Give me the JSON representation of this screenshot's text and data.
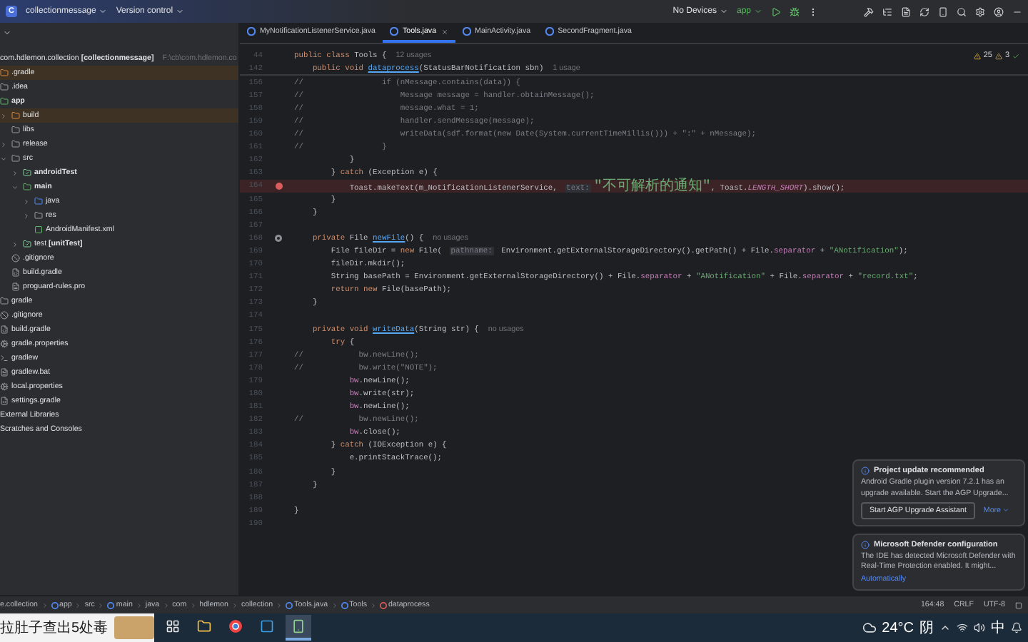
{
  "toolbar": {
    "project_initial": "C",
    "project": "collectionmessage",
    "vcs": "Version control",
    "device": "No Devices",
    "run_config": "app"
  },
  "tabs": [
    {
      "label": "MyNotificationListenerService.java",
      "selected": false
    },
    {
      "label": "Tools.java",
      "selected": true
    },
    {
      "label": "MainActivity.java",
      "selected": false
    },
    {
      "label": "SecondFragment.java",
      "selected": false
    }
  ],
  "project_tree": {
    "root": "com.hdlemon.collection **[collectionmessage]**",
    "root_path": "F:\\cb\\com.hdlemon.co",
    "items": [
      {
        "label": ".gradle",
        "kind": "excluded",
        "highlighted": true
      },
      {
        "label": ".idea",
        "kind": "folder",
        "highlighted": false
      },
      {
        "label": "**app**",
        "kind": "module",
        "highlighted": false,
        "children": [
          {
            "label": "build",
            "kind": "excluded",
            "highlighted": true,
            "expanded": false
          },
          {
            "label": "libs",
            "kind": "folder",
            "highlighted": false
          },
          {
            "label": "release",
            "kind": "folder",
            "highlighted": false,
            "expanded": false
          },
          {
            "label": "src",
            "kind": "folder",
            "highlighted": false,
            "expanded": true,
            "children": [
              {
                "label": "**androidTest**",
                "kind": "test",
                "highlighted": false,
                "expanded": false
              },
              {
                "label": "**main**",
                "kind": "module",
                "highlighted": false,
                "expanded": true,
                "children": [
                  {
                    "label": "java",
                    "kind": "source",
                    "highlighted": false,
                    "expanded": false
                  },
                  {
                    "label": "res",
                    "kind": "folder",
                    "highlighted": false,
                    "expanded": false
                  },
                  {
                    "label": "AndroidManifest.xml",
                    "kind": "manifest",
                    "highlighted": false
                  }
                ]
              },
              {
                "label": "test **[unitTest]**",
                "kind": "test",
                "highlighted": false,
                "expanded": false
              }
            ]
          },
          {
            "label": ".gitignore",
            "kind": "ignore",
            "highlighted": false
          },
          {
            "label": "build.gradle",
            "kind": "gradle",
            "highlighted": false
          },
          {
            "label": "proguard-rules.pro",
            "kind": "lines",
            "highlighted": false
          }
        ]
      },
      {
        "label": "gradle",
        "kind": "folder",
        "highlighted": false
      },
      {
        "label": ".gitignore",
        "kind": "ignore",
        "highlighted": false
      },
      {
        "label": "build.gradle",
        "kind": "gradle",
        "highlighted": false
      },
      {
        "label": "gradle.properties",
        "kind": "settings",
        "highlighted": false
      },
      {
        "label": "gradlew",
        "kind": "script",
        "highlighted": false
      },
      {
        "label": "gradlew.bat",
        "kind": "lines",
        "highlighted": false
      },
      {
        "label": "local.properties",
        "kind": "settings",
        "highlighted": false
      },
      {
        "label": "settings.gradle",
        "kind": "gradle",
        "highlighted": false
      },
      {
        "label": "External Libraries",
        "kind": "plain",
        "highlighted": false
      },
      {
        "label": "Scratches and Consoles",
        "kind": "plain",
        "highlighted": false
      }
    ]
  },
  "editor": {
    "warnings": "25",
    "weak_warnings": "3",
    "sticky": [
      {
        "number": "44",
        "tokens": [
          {
            "kind": "kw",
            "text": "public class "
          },
          {
            "kind": "txt",
            "text": "Tools {  "
          },
          {
            "kind": "hint",
            "text": "12 usages"
          }
        ]
      },
      {
        "number": "142",
        "tokens": [
          {
            "kind": "kw",
            "text": "    public void "
          },
          {
            "kind": "fn",
            "text": "dataprocess"
          },
          {
            "kind": "txt",
            "text": "(StatusBarNotification sbn)  "
          },
          {
            "kind": "hint",
            "text": "1 usage"
          }
        ]
      }
    ],
    "lines": [
      {
        "number": "156",
        "breakpoint": false,
        "annotated": false,
        "tokens": [
          {
            "kind": "com",
            "text": "//                 if (nMessage.contains(data)) {"
          }
        ]
      },
      {
        "number": "157",
        "breakpoint": false,
        "annotated": false,
        "tokens": [
          {
            "kind": "com",
            "text": "//                     Message message = handler.obtainMessage();"
          }
        ]
      },
      {
        "number": "158",
        "breakpoint": false,
        "annotated": false,
        "tokens": [
          {
            "kind": "com",
            "text": "//                     message.what = 1;"
          }
        ]
      },
      {
        "number": "159",
        "breakpoint": false,
        "annotated": false,
        "tokens": [
          {
            "kind": "com",
            "text": "//                     handler.sendMessage(message);"
          }
        ]
      },
      {
        "number": "160",
        "breakpoint": false,
        "annotated": false,
        "tokens": [
          {
            "kind": "com",
            "text": "//                     writeData(sdf.format(new Date(System.currentTimeMillis())) + \":\" + nMessage);"
          }
        ]
      },
      {
        "number": "161",
        "breakpoint": false,
        "annotated": false,
        "tokens": [
          {
            "kind": "com",
            "text": "//                 }"
          }
        ]
      },
      {
        "number": "162",
        "breakpoint": false,
        "annotated": false,
        "tokens": [
          {
            "kind": "txt",
            "text": "            }"
          }
        ]
      },
      {
        "number": "163",
        "breakpoint": false,
        "annotated": false,
        "tokens": [
          {
            "kind": "txt",
            "text": "        } "
          },
          {
            "kind": "kw",
            "text": "catch "
          },
          {
            "kind": "txt",
            "text": "(Exception e) {"
          }
        ]
      },
      {
        "number": "164",
        "breakpoint": true,
        "annotated": false,
        "tokens": [
          {
            "kind": "txt",
            "text": "            Toast.makeText(m_NotificationListenerService, "
          },
          {
            "kind": "chip",
            "text": "text:"
          },
          {
            "kind": "str",
            "text": "\"不可解析的通知\""
          },
          {
            "kind": "txt",
            "text": ", Toast."
          },
          {
            "kind": "ital",
            "text": "LENGTH_SHORT"
          },
          {
            "kind": "txt",
            "text": ").show();"
          }
        ]
      },
      {
        "number": "165",
        "breakpoint": false,
        "annotated": false,
        "tokens": [
          {
            "kind": "txt",
            "text": "        }"
          }
        ]
      },
      {
        "number": "166",
        "breakpoint": false,
        "annotated": false,
        "tokens": [
          {
            "kind": "txt",
            "text": "    }"
          }
        ]
      },
      {
        "number": "167",
        "breakpoint": false,
        "annotated": false
      },
      {
        "number": "168",
        "breakpoint": false,
        "annotated": true,
        "tokens": [
          {
            "kind": "kw",
            "text": "    private "
          },
          {
            "kind": "txt",
            "text": "File "
          },
          {
            "kind": "fn",
            "text": "newFile"
          },
          {
            "kind": "txt",
            "text": "() {  "
          },
          {
            "kind": "hint",
            "text": "no usages"
          }
        ]
      },
      {
        "number": "169",
        "breakpoint": false,
        "annotated": false,
        "tokens": [
          {
            "kind": "txt",
            "text": "        File fileDir = "
          },
          {
            "kind": "kw",
            "text": "new "
          },
          {
            "kind": "txt",
            "text": "File( "
          },
          {
            "kind": "chip",
            "text": "pathname:"
          },
          {
            "kind": "txt",
            "text": " Environment.getExternalStorageDirectory().getPath() + File."
          },
          {
            "kind": "fld",
            "text": "separator"
          },
          {
            "kind": "txt",
            "text": " + "
          },
          {
            "kind": "str",
            "text": "\"ANotification\""
          },
          {
            "kind": "txt",
            "text": ");"
          }
        ]
      },
      {
        "number": "170",
        "breakpoint": false,
        "annotated": false,
        "tokens": [
          {
            "kind": "txt",
            "text": "        fileDir.mkdir();"
          }
        ]
      },
      {
        "number": "171",
        "breakpoint": false,
        "annotated": false,
        "tokens": [
          {
            "kind": "txt",
            "text": "        String basePath = Environment.getExternalStorageDirectory() + File."
          },
          {
            "kind": "fld",
            "text": "separator"
          },
          {
            "kind": "txt",
            "text": " + "
          },
          {
            "kind": "str",
            "text": "\"ANotification\""
          },
          {
            "kind": "txt",
            "text": " + File."
          },
          {
            "kind": "fld",
            "text": "separator"
          },
          {
            "kind": "txt",
            "text": " + "
          },
          {
            "kind": "str",
            "text": "\"record.txt\""
          },
          {
            "kind": "txt",
            "text": ";"
          }
        ]
      },
      {
        "number": "172",
        "breakpoint": false,
        "annotated": false,
        "tokens": [
          {
            "kind": "kw",
            "text": "        return new "
          },
          {
            "kind": "txt",
            "text": "File(basePath);"
          }
        ]
      },
      {
        "number": "173",
        "breakpoint": false,
        "annotated": false,
        "tokens": [
          {
            "kind": "txt",
            "text": "    }"
          }
        ]
      },
      {
        "number": "174",
        "breakpoint": false,
        "annotated": false
      },
      {
        "number": "175",
        "breakpoint": false,
        "annotated": false,
        "tokens": [
          {
            "kind": "kw",
            "text": "    private void "
          },
          {
            "kind": "fn",
            "text": "writeData"
          },
          {
            "kind": "txt",
            "text": "(String str) {  "
          },
          {
            "kind": "hint",
            "text": "no usages"
          }
        ]
      },
      {
        "number": "176",
        "breakpoint": false,
        "annotated": false,
        "tokens": [
          {
            "kind": "kw",
            "text": "        try "
          },
          {
            "kind": "txt",
            "text": "{"
          }
        ]
      },
      {
        "number": "177",
        "breakpoint": false,
        "annotated": false,
        "tokens": [
          {
            "kind": "com",
            "text": "//            bw.newLine();"
          }
        ]
      },
      {
        "number": "178",
        "breakpoint": false,
        "annotated": false,
        "tokens": [
          {
            "kind": "com",
            "text": "//            bw.write(\"NOTE\");"
          }
        ]
      },
      {
        "number": "179",
        "breakpoint": false,
        "annotated": false,
        "tokens": [
          {
            "kind": "fld",
            "text": "            bw"
          },
          {
            "kind": "txt",
            "text": ".newLine();"
          }
        ]
      },
      {
        "number": "180",
        "breakpoint": false,
        "annotated": false,
        "tokens": [
          {
            "kind": "fld",
            "text": "            bw"
          },
          {
            "kind": "txt",
            "text": ".write(str);"
          }
        ]
      },
      {
        "number": "181",
        "breakpoint": false,
        "annotated": false,
        "tokens": [
          {
            "kind": "fld",
            "text": "            bw"
          },
          {
            "kind": "txt",
            "text": ".newLine();"
          }
        ]
      },
      {
        "number": "182",
        "breakpoint": false,
        "annotated": false,
        "tokens": [
          {
            "kind": "com",
            "text": "//            bw.newLine();"
          }
        ]
      },
      {
        "number": "183",
        "breakpoint": false,
        "annotated": false,
        "tokens": [
          {
            "kind": "fld",
            "text": "            bw"
          },
          {
            "kind": "txt",
            "text": ".close();"
          }
        ]
      },
      {
        "number": "184",
        "breakpoint": false,
        "annotated": false,
        "tokens": [
          {
            "kind": "txt",
            "text": "        } "
          },
          {
            "kind": "kw",
            "text": "catch "
          },
          {
            "kind": "txt",
            "text": "(IOException e) {"
          }
        ]
      },
      {
        "number": "185",
        "breakpoint": false,
        "annotated": false,
        "tokens": [
          {
            "kind": "txt",
            "text": "            e.printStackTrace();"
          }
        ]
      },
      {
        "number": "186",
        "breakpoint": false,
        "annotated": false,
        "tokens": [
          {
            "kind": "txt",
            "text": "        }"
          }
        ]
      },
      {
        "number": "187",
        "breakpoint": false,
        "annotated": false,
        "tokens": [
          {
            "kind": "txt",
            "text": "    }"
          }
        ]
      },
      {
        "number": "188",
        "breakpoint": false,
        "annotated": false
      },
      {
        "number": "189",
        "breakpoint": false,
        "annotated": false,
        "tokens": [
          {
            "kind": "txt",
            "text": "}"
          }
        ]
      },
      {
        "number": "190",
        "breakpoint": false,
        "annotated": false
      }
    ]
  },
  "notifications": [
    {
      "title": "Project update recommended",
      "body": "Android Gradle plugin version 7.2.1 has an upgrade available. Start the AGP Upgrade...",
      "action": "Start AGP Upgrade Assistant",
      "link": "More"
    },
    {
      "title": "Microsoft Defender configuration",
      "body": "The IDE has detected Microsoft Defender with Real-Time Protection enabled. It might...",
      "link": "Automatically"
    }
  ],
  "status_bar": {
    "breadcrumbs": [
      {
        "label": "e.collection",
        "kind": "plain"
      },
      {
        "label": "app",
        "kind": "module"
      },
      {
        "label": "src",
        "kind": "plain"
      },
      {
        "label": "main",
        "kind": "module"
      },
      {
        "label": "java",
        "kind": "plain"
      },
      {
        "label": "com",
        "kind": "plain"
      },
      {
        "label": "hdlemon",
        "kind": "plain"
      },
      {
        "label": "collection",
        "kind": "plain"
      },
      {
        "label": "Tools.java",
        "kind": "class"
      },
      {
        "label": "Tools",
        "kind": "class"
      },
      {
        "label": "dataprocess",
        "kind": "method"
      }
    ],
    "position": "164:48",
    "line_separator": "CRLF",
    "encoding": "UTF-8"
  },
  "taskbar": {
    "search_text": "拉肚子查出5处毒",
    "apps": [
      {
        "kind": "taskview",
        "selected": false
      },
      {
        "kind": "explorer",
        "selected": false
      },
      {
        "kind": "chrome",
        "selected": false
      },
      {
        "kind": "store",
        "selected": false
      },
      {
        "kind": "studio",
        "selected": true
      }
    ],
    "temperature": "24°C",
    "weather": "阴",
    "ime": "中"
  }
}
